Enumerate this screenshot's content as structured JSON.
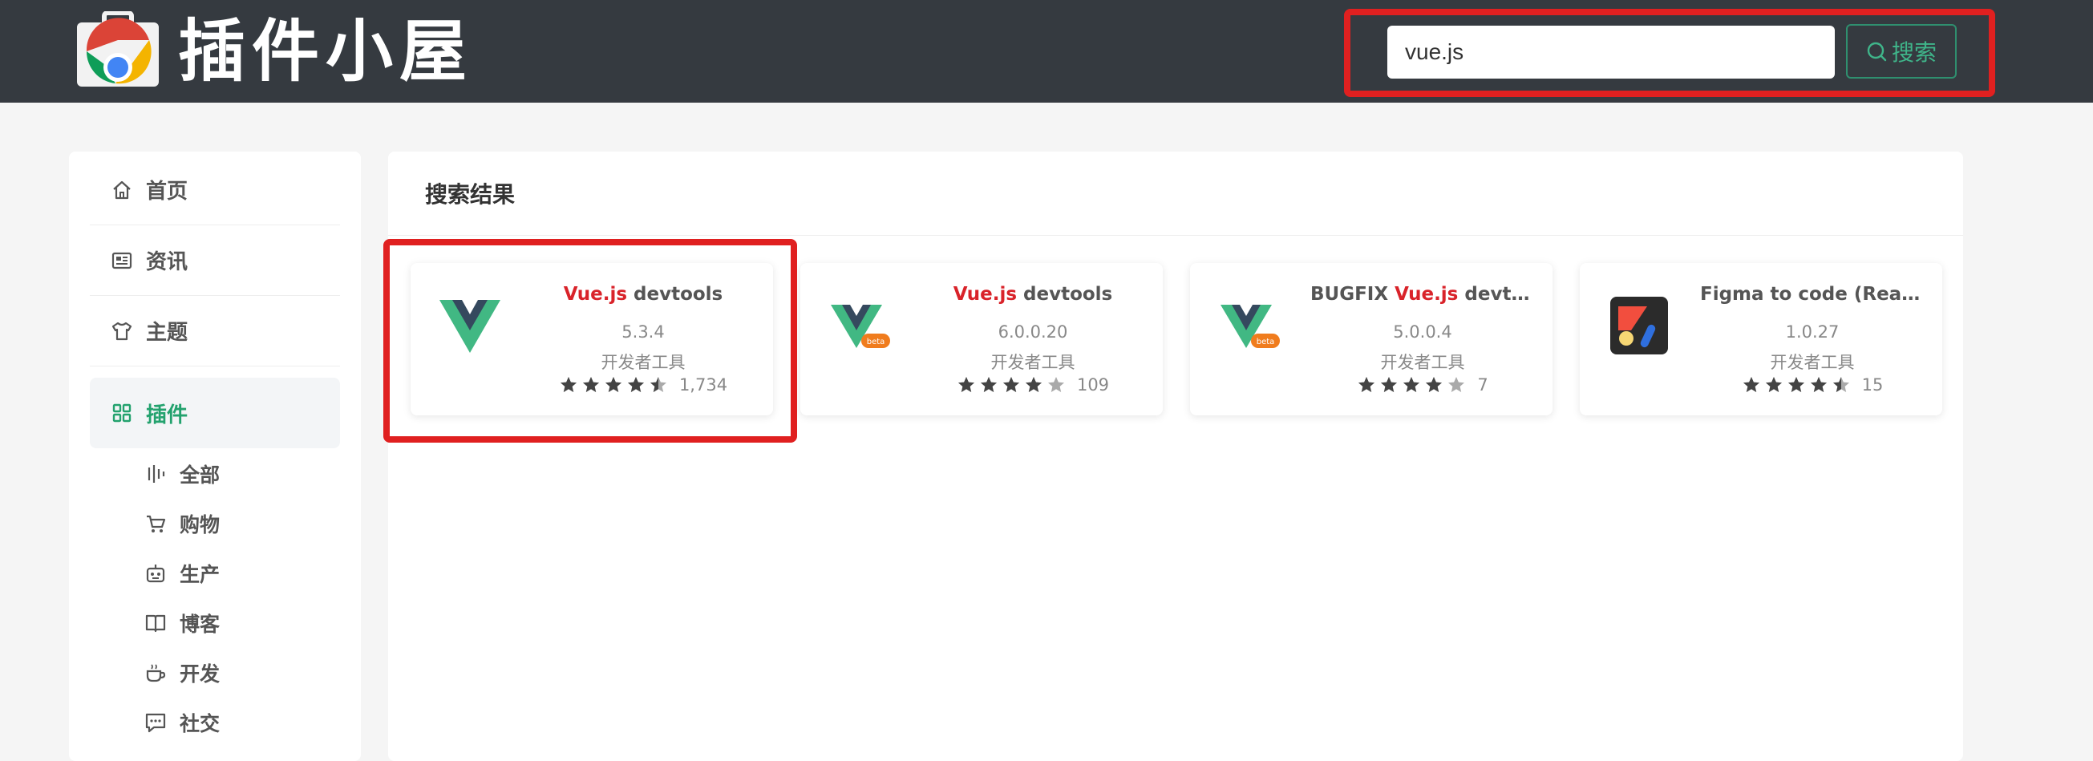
{
  "header": {
    "logo_text": "插件小屋",
    "search": {
      "value": "vue.js",
      "placeholder": ""
    },
    "search_button": "搜索"
  },
  "sidebar": {
    "items": [
      {
        "label": "首页",
        "icon": "home-icon"
      },
      {
        "label": "资讯",
        "icon": "news-icon"
      },
      {
        "label": "主题",
        "icon": "shirt-icon"
      },
      {
        "label": "插件",
        "icon": "grid-icon",
        "active": true
      }
    ],
    "sub_items": [
      {
        "label": "全部",
        "icon": "bars-icon"
      },
      {
        "label": "购物",
        "icon": "cart-icon"
      },
      {
        "label": "生产",
        "icon": "robot-icon"
      },
      {
        "label": "博客",
        "icon": "book-icon"
      },
      {
        "label": "开发",
        "icon": "coffee-icon"
      },
      {
        "label": "社交",
        "icon": "chat-icon"
      }
    ]
  },
  "main": {
    "title": "搜索结果",
    "results": [
      {
        "prefix": "",
        "highlight": "Vue.js",
        "suffix": " devtools",
        "version": "5.3.4",
        "category": "开发者工具",
        "rating": 4.5,
        "count": "1,734",
        "icon": "vue-icon"
      },
      {
        "prefix": "",
        "highlight": "Vue.js",
        "suffix": " devtools",
        "version": "6.0.0.20",
        "category": "开发者工具",
        "rating": 4,
        "count": "109",
        "icon": "vue-beta-icon"
      },
      {
        "prefix": "BUGFIX ",
        "highlight": "Vue.js",
        "suffix": " devtools",
        "version": "5.0.0.4",
        "category": "开发者工具",
        "rating": 4,
        "count": "7",
        "icon": "vue-beta-icon"
      },
      {
        "prefix": "Figma to code (React/...",
        "highlight": "",
        "suffix": "",
        "version": "1.0.27",
        "category": "开发者工具",
        "rating": 4.5,
        "count": "15",
        "icon": "figma-to-code-icon"
      }
    ]
  },
  "colors": {
    "header_bg": "#353a40",
    "accent": "#23a26e",
    "highlight": "#d9232a",
    "annotation_box": "#e02020"
  }
}
